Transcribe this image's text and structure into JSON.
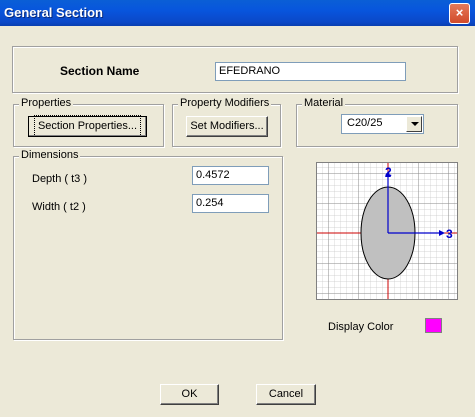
{
  "window": {
    "title": "General Section",
    "close_glyph": "×"
  },
  "section_name": {
    "label": "Section Name",
    "value": "EFEDRANO"
  },
  "properties": {
    "legend": "Properties",
    "button_label": "Section Properties..."
  },
  "property_modifiers": {
    "legend": "Property Modifiers",
    "button_label": "Set Modifiers..."
  },
  "material": {
    "legend": "Material",
    "selected": "C20/25"
  },
  "dimensions": {
    "legend": "Dimensions",
    "depth_label": "Depth  ( t3 )",
    "depth_value": "0.4572",
    "width_label": "Width  ( t2 )",
    "width_value": "0.254"
  },
  "preview": {
    "axis2_label": "2",
    "axis3_label": "3",
    "shape_fill": "#c0c0c0",
    "axis_color": "#0000cc",
    "center_line_color": "#cc0000"
  },
  "display_color": {
    "label": "Display Color",
    "color": "#ff00ff"
  },
  "buttons": {
    "ok_label": "OK",
    "cancel_label": "Cancel"
  }
}
